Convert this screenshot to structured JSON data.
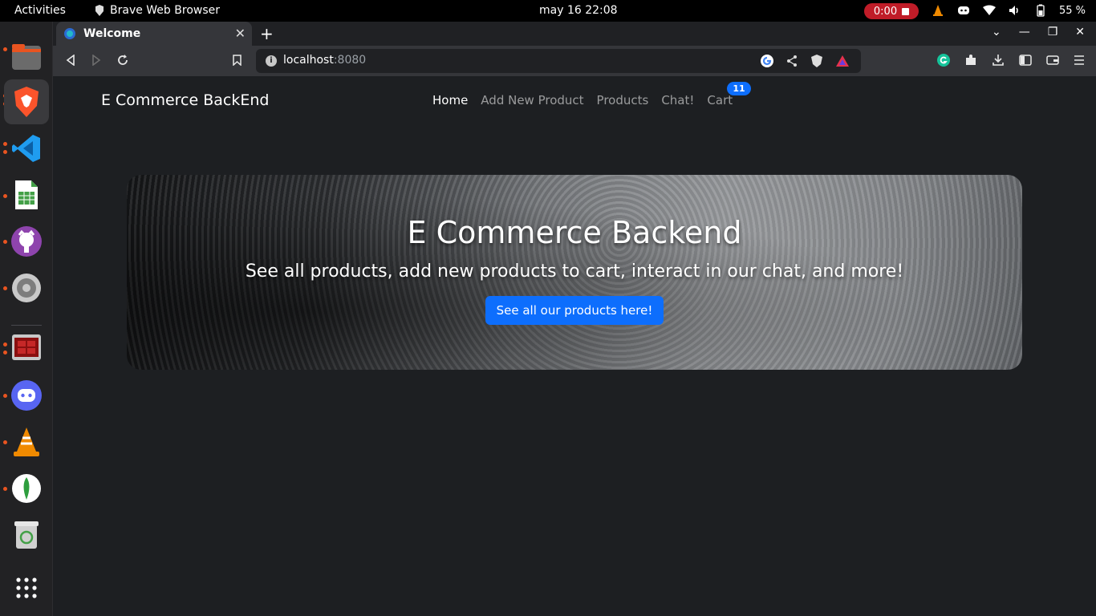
{
  "topbar": {
    "activities": "Activities",
    "app_name": "Brave Web Browser",
    "clock": "may 16  22:08",
    "recording": "0:00",
    "battery": "55 %"
  },
  "browser": {
    "tab_title": "Welcome",
    "url_host": "localhost",
    "url_port": ":8080"
  },
  "page": {
    "brand": "E Commerce BackEnd",
    "nav": [
      "Home",
      "Add New Product",
      "Products",
      "Chat!",
      "Cart"
    ],
    "cart_count": "11",
    "hero": {
      "title": "E Commerce Backend",
      "subtitle": "See all products, add new products to cart, interact in our chat, and more!",
      "button": "See all our products here!"
    }
  },
  "colors": {
    "accent": "#0d6efd",
    "page_bg": "#1d1f22",
    "recording": "#c01c28"
  },
  "dock_icons": [
    "files-icon",
    "brave-icon",
    "vscode-icon",
    "spreadsheet-icon",
    "github-icon",
    "settings-icon",
    "terminal-icon",
    "discord-icon",
    "vlc-icon",
    "mongodb-icon",
    "trash-icon",
    "apps-grid-icon"
  ]
}
